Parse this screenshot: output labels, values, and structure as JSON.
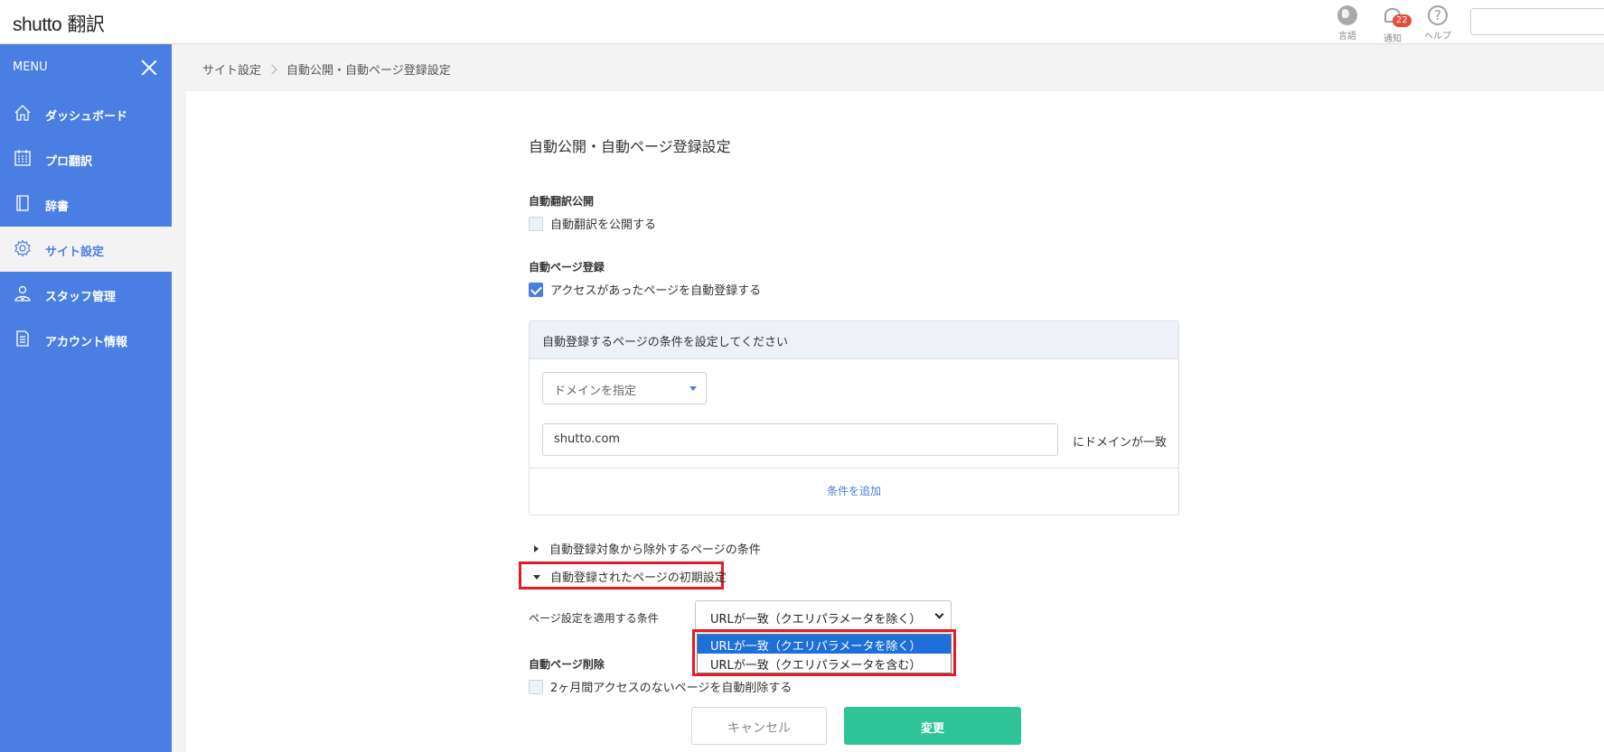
{
  "header": {
    "logo_latin": "shutto",
    "logo_jp": "翻訳",
    "language_label": "言語",
    "notifications_label": "通知",
    "notifications_count": "22",
    "help_label": "ヘルプ",
    "help_glyph": "?"
  },
  "sidebar": {
    "menu_label": "MENU",
    "items": [
      {
        "label": "ダッシュボード",
        "icon": "home-icon"
      },
      {
        "label": "プロ翻訳",
        "icon": "calendar-grid-icon"
      },
      {
        "label": "辞書",
        "icon": "book-icon"
      },
      {
        "label": "サイト設定",
        "icon": "gear-icon",
        "active": true
      },
      {
        "label": "スタッフ管理",
        "icon": "staff-icon"
      },
      {
        "label": "アカウント情報",
        "icon": "document-icon"
      }
    ]
  },
  "breadcrumb": {
    "parent": "サイト設定",
    "current": "自動公開・自動ページ登録設定"
  },
  "main": {
    "title": "自動公開・自動ページ登録設定",
    "auto_publish": {
      "heading": "自動翻訳公開",
      "checkbox_label": "自動翻訳を公開する",
      "checked": false
    },
    "auto_register": {
      "heading": "自動ページ登録",
      "checkbox_label": "アクセスがあったページを自動登録する",
      "checked": true
    },
    "conditions": {
      "header": "自動登録するページの条件を設定してください",
      "domain_select": "ドメインを指定",
      "domain_value": "shutto.com",
      "domain_suffix": "にドメインが一致",
      "add_condition": "条件を追加"
    },
    "exclude_toggle": "自動登録対象から除外するページの条件",
    "initial_settings_toggle": "自動登録されたページの初期設定",
    "apply_condition_label": "ページ設定を適用する条件",
    "apply_condition_value": "URLが一致（クエリパラメータを除く）",
    "apply_condition_options": [
      "URLが一致（クエリパラメータを除く）",
      "URLが一致（クエリパラメータを含む）"
    ],
    "auto_delete": {
      "heading": "自動ページ削除",
      "checkbox_label": "2ヶ月間アクセスのないページを自動削除する",
      "checked": false
    },
    "cancel_button": "キャンセル",
    "submit_button": "変更"
  },
  "colors": {
    "sidebar": "#4a7ee3",
    "primary_button": "#2fc497",
    "highlight_box": "#e51b23",
    "dropdown_selected": "#1e6fd9"
  }
}
